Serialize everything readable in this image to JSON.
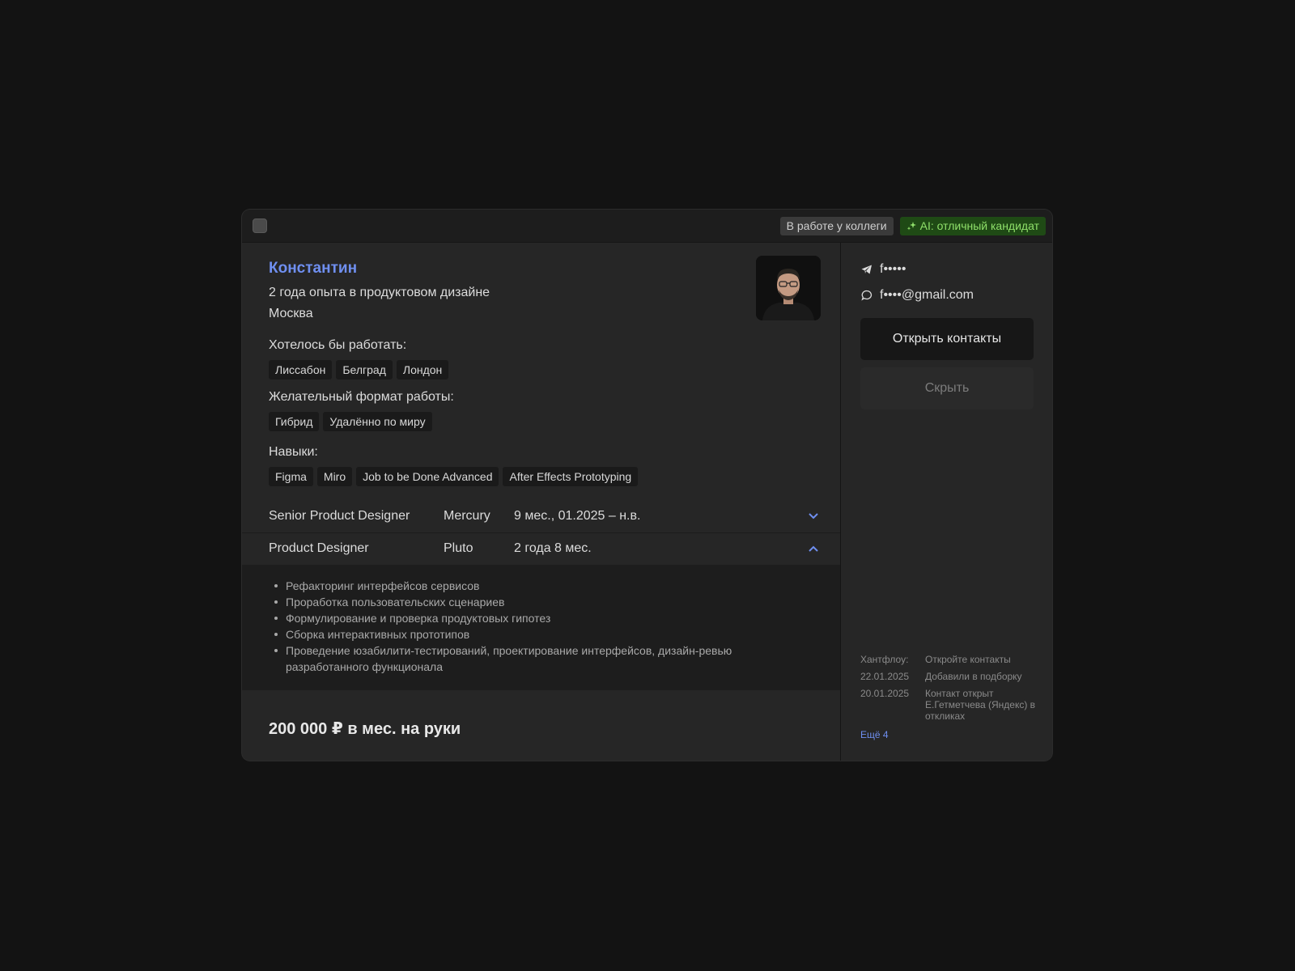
{
  "header": {
    "badge_colleague": "В работе у коллеги",
    "badge_ai": "AI: отличный кандидат"
  },
  "candidate": {
    "name": "Константин",
    "experience": "2 года опыта в продуктовом дизайне",
    "city": "Москва",
    "salary": "200 000 ₽ в мес. на руки"
  },
  "sections": {
    "locations_label": "Хотелось бы работать:",
    "locations": [
      "Лиссабон",
      "Белград",
      "Лондон"
    ],
    "format_label": "Желательный формат работы:",
    "formats": [
      "Гибрид",
      "Удалённо по миру"
    ],
    "skills_label": "Навыки:",
    "skills": [
      "Figma",
      "Miro",
      "Job to be Done Advanced",
      "After Effects Prototyping"
    ]
  },
  "jobs": [
    {
      "title": "Senior Product Designer",
      "company": "Mercury",
      "period": "9 мес., 01.2025 – н.в.",
      "expanded": false
    },
    {
      "title": "Product Designer",
      "company": "Pluto",
      "period": "2 года 8 мес.",
      "expanded": true,
      "duties": [
        "Рефакторинг интерфейсов сервисов",
        "Проработка пользовательских сценариев",
        "Формулирование и проверка продуктовых гипотез",
        "Сборка интерактивных прототипов",
        "Проведение юзабилити-тестирований, проектирование интерфейсов, дизайн-ревью разработанного функционала"
      ]
    }
  ],
  "contacts": {
    "telegram": "f•••••",
    "email": "f••••@gmail.com",
    "open_label": "Открыть контакты",
    "hide_label": "Скрыть"
  },
  "history": [
    {
      "key": "Хантфлоу:",
      "value": "Откройте контакты"
    },
    {
      "key": "22.01.2025",
      "value": "Добавили в подборку"
    },
    {
      "key": "20.01.2025",
      "value": "Контакт открыт Е.Гетметчева (Яндекс) в откликах"
    }
  ],
  "history_more": "Ещё 4",
  "colors": {
    "accent": "#6f8ff0",
    "ai_badge_bg": "#1f4a15",
    "ai_badge_text": "#8fe06a"
  }
}
